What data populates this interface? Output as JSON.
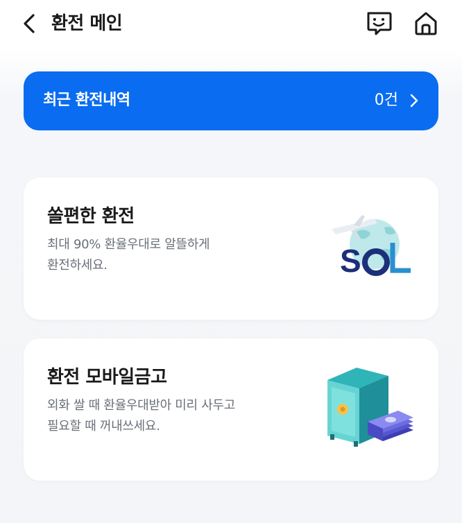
{
  "header": {
    "title": "환전 메인",
    "icons": [
      "back-icon",
      "chatbot-icon",
      "home-icon"
    ]
  },
  "recent": {
    "label": "최근 환전내역",
    "count": "0건",
    "color": "#0a6cf0"
  },
  "cards": [
    {
      "title": "쏠편한 환전",
      "desc_line1": "최대 90% 환율우대로 알뜰하게",
      "desc_line2": "환전하세요.",
      "icon": "sol-globe-airplane-icon"
    },
    {
      "title": "환전 모바일금고",
      "desc_line1": "외화 쌀 때 환율우대받아 미리 사두고",
      "desc_line2": "필요할 때 꺼내쓰세요.",
      "icon": "safe-money-icon"
    }
  ]
}
